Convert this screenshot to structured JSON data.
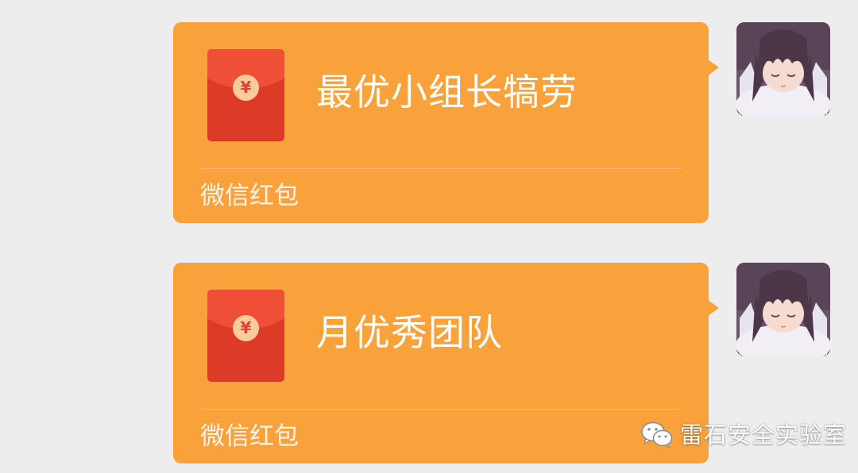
{
  "messages": [
    {
      "title": "最优小组长犒劳",
      "label": "微信红包",
      "envelope_icon": "red-envelope-icon",
      "coin_symbol": "¥"
    },
    {
      "title": "月优秀团队",
      "label": "微信红包",
      "envelope_icon": "red-envelope-icon",
      "coin_symbol": "¥"
    }
  ],
  "watermark": {
    "icon": "wechat-icon",
    "text": "雷石安全实验室"
  },
  "colors": {
    "background": "#ededed",
    "bubble": "#f9a23c",
    "envelope": "#dd3a27",
    "envelope_flap": "#ee4f36",
    "coin": "#fbcc9b"
  }
}
